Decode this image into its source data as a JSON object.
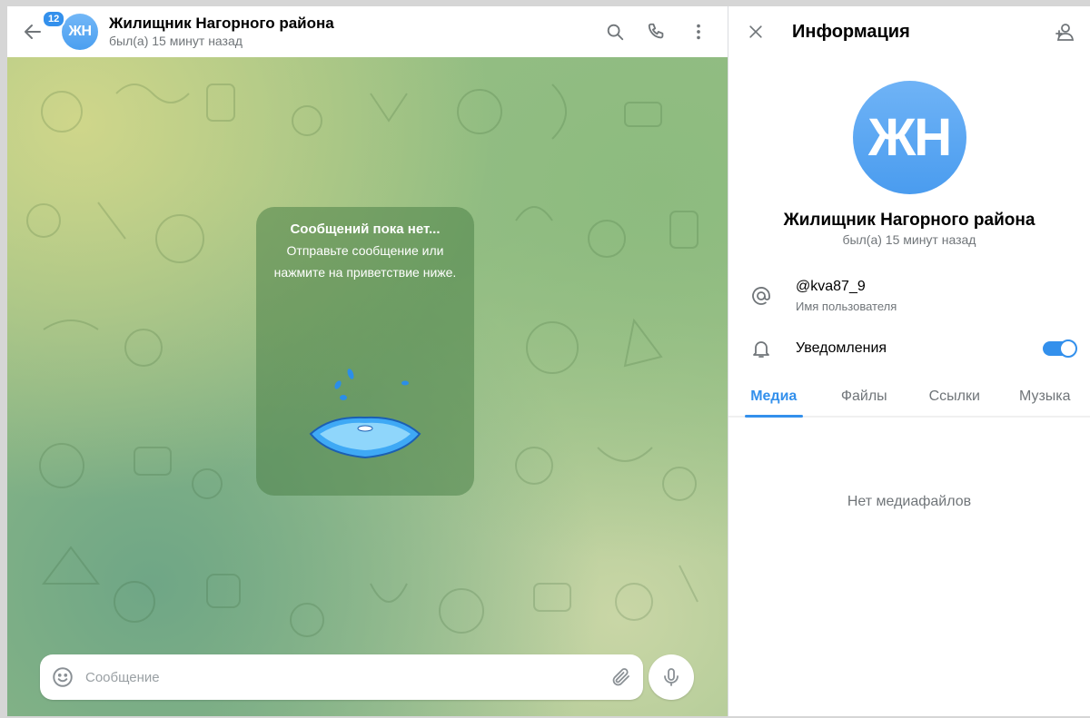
{
  "chat": {
    "unread_count": "12",
    "avatar_initials": "ЖН",
    "title": "Жилищник Нагорного района",
    "status": "был(а) 15 минут назад",
    "empty_title": "Сообщений пока нет...",
    "empty_subtitle": "Отправьте сообщение или нажмите на приветствие ниже.",
    "composer_placeholder": "Сообщение"
  },
  "info": {
    "title": "Информация",
    "avatar_initials": "ЖН",
    "name": "Жилищник Нагорного района",
    "status": "был(а) 15 минут назад",
    "username": "@kva87_9",
    "username_label": "Имя пользователя",
    "notifications_label": "Уведомления",
    "notifications_on": true,
    "tabs": [
      {
        "label": "Медиа",
        "active": true
      },
      {
        "label": "Файлы",
        "active": false
      },
      {
        "label": "Ссылки",
        "active": false
      },
      {
        "label": "Музыка",
        "active": false
      }
    ],
    "empty_media": "Нет медиафайлов"
  },
  "colors": {
    "accent": "#3390ec",
    "secondary_text": "#707579"
  },
  "icons": [
    "back-arrow-icon",
    "search-icon",
    "phone-icon",
    "more-vertical-icon",
    "close-icon",
    "add-contact-icon",
    "at-icon",
    "bell-icon",
    "emoji-icon",
    "attach-icon",
    "mic-icon"
  ]
}
